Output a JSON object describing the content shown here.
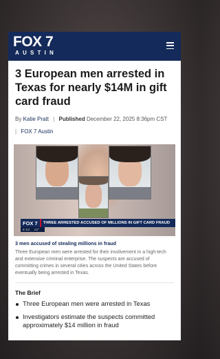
{
  "header": {
    "logo_main": "FOX 7",
    "logo_sub": "AUSTIN",
    "menu_icon": "hamburger-menu-icon",
    "background_color": "#142a5a"
  },
  "article": {
    "headline": "3 European men arrested in Texas for nearly $14M in gift card fraud",
    "byline_prefix": "By",
    "author": "Katie Pratt",
    "published_label": "Published",
    "published_date": "December 22, 2025 8:36pm CST",
    "station": "FOX 7 Austin"
  },
  "hero": {
    "banner_logo": "FOX 7",
    "banner_text": "THREE ARRESTED ACCUSED OF MILLIONS IN GIFT CARD FRAUD",
    "banner_time": "9:02",
    "banner_temp": "43°",
    "accent_color": "#c8102e"
  },
  "caption": {
    "title": "3 men accused of stealing millions in fraud",
    "text": "Three European men were arrested for their involvement in a high-tech and extensive criminal enterprise. The suspects are accused of committing crimes in several cities across the United States before eventually being arrested in Texas."
  },
  "brief": {
    "title": "The Brief",
    "items": [
      "Three European men were arrested in Texas",
      "Investigators estimate the suspects committed approximately $14 million in fraud"
    ]
  }
}
